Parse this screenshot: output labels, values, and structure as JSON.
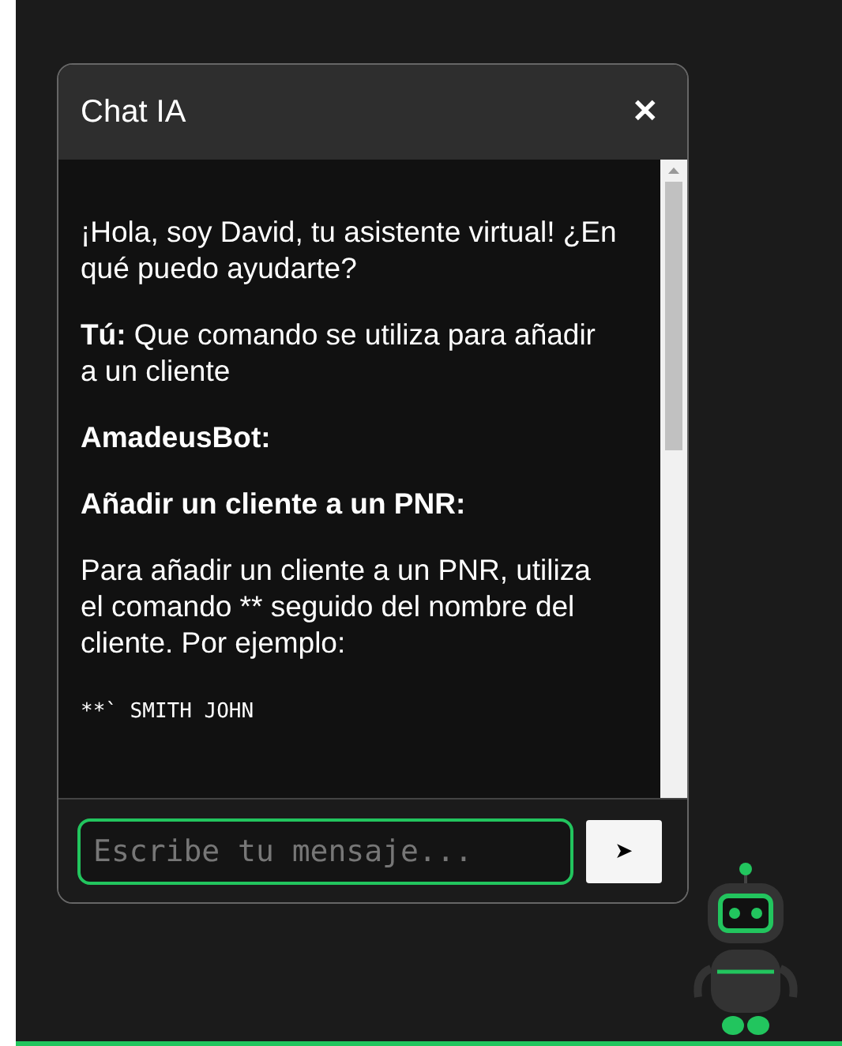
{
  "chat": {
    "title": "Chat IA",
    "close": "✕",
    "messages": [
      {
        "kind": "text",
        "text": "¡Hola, soy David, tu asistente virtual! ¿En qué puedo ayudarte?"
      },
      {
        "kind": "user",
        "text": "**Tú:** Que comando se utiliza para añadir a un cliente"
      },
      {
        "kind": "heading",
        "text": "AmadeusBot:"
      },
      {
        "kind": "heading",
        "text": "Añadir un cliente a un PNR:"
      },
      {
        "kind": "text",
        "text": "Para añadir un cliente a un PNR, utiliza el comando ** seguido del nombre del cliente. Por ejemplo:"
      },
      {
        "kind": "code",
        "text": "**` SMITH JOHN"
      }
    ],
    "input": {
      "placeholder": "Escribe tu mensaje..."
    },
    "send": "➤"
  }
}
